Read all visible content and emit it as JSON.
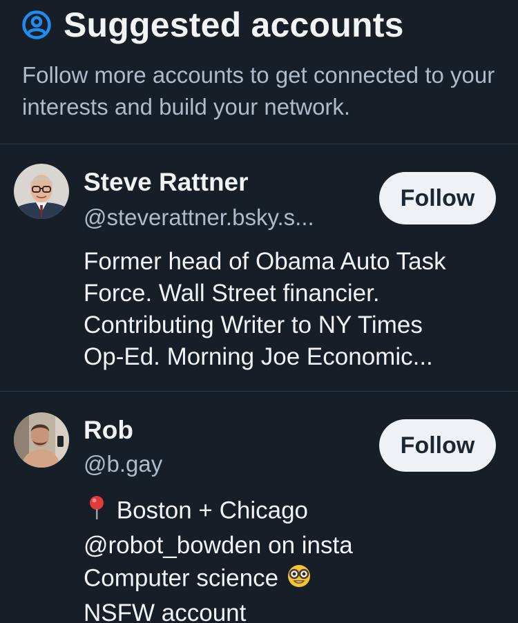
{
  "header": {
    "icon": "user-circle-icon",
    "title": "Suggested accounts",
    "subtitle": "Follow more accounts to get connected to your interests and build your network."
  },
  "accounts": [
    {
      "name": "Steve Rattner",
      "handle": "@steverattner.bsky.s...",
      "follow_label": "Follow",
      "avatar": "avatar-photo-steve",
      "bio_lines": [
        "Former head of Obama Auto Task",
        "Force. Wall Street financier.",
        "Contributing Writer to NY Times",
        "Op-Ed. Morning Joe Economic..."
      ]
    },
    {
      "name": "Rob",
      "handle": "@b.gay",
      "follow_label": "Follow",
      "avatar": "avatar-photo-rob",
      "bio_lines": [
        "Boston + Chicago",
        "@robot_bowden on insta",
        "Computer science",
        "NSFW account"
      ],
      "bio_emojis": [
        "pin-emoji",
        "nerd-face-emoji"
      ]
    }
  ],
  "colors": {
    "background": "#161e27",
    "accent": "#1f8cf0",
    "muted_text": "#aebbc9",
    "button_bg": "#eef2f6",
    "divider": "#2e3a48"
  }
}
